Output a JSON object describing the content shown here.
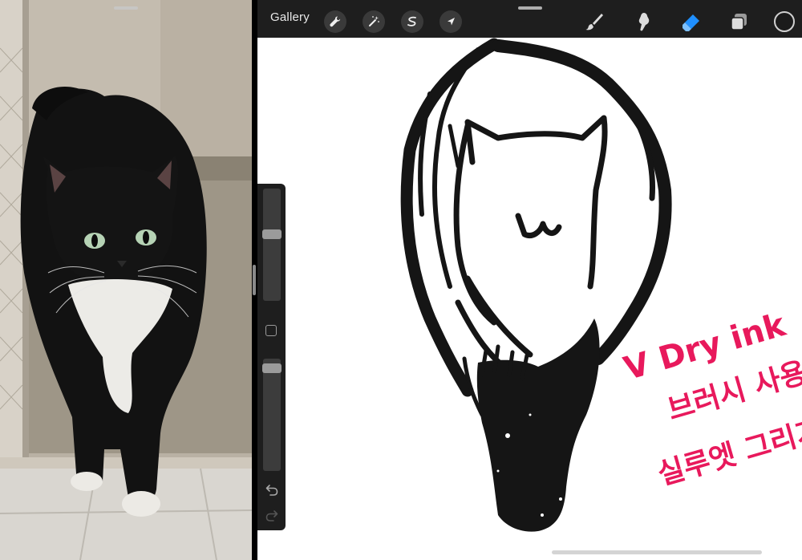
{
  "toolbar": {
    "gallery_label": "Gallery",
    "tools_left": [
      "wrench-icon",
      "magic-wand-icon",
      "selection-icon",
      "transform-arrow-icon"
    ],
    "tools_right": [
      "brush-icon",
      "smudge-icon",
      "eraser-icon",
      "layers-icon"
    ],
    "active_tool": "eraser-icon"
  },
  "color_swatch": "#1b1b1b",
  "accent_color": "#1f8fff",
  "note": {
    "lines": [
      "V Dry ink",
      "브러시 사용",
      "실루엣 그리기"
    ],
    "color": "#e8195c"
  },
  "sidebar": {
    "brush_size_level": 0.6,
    "opacity_level": 0.95,
    "undo_icon": "undo-icon",
    "redo_icon": "redo-icon"
  }
}
